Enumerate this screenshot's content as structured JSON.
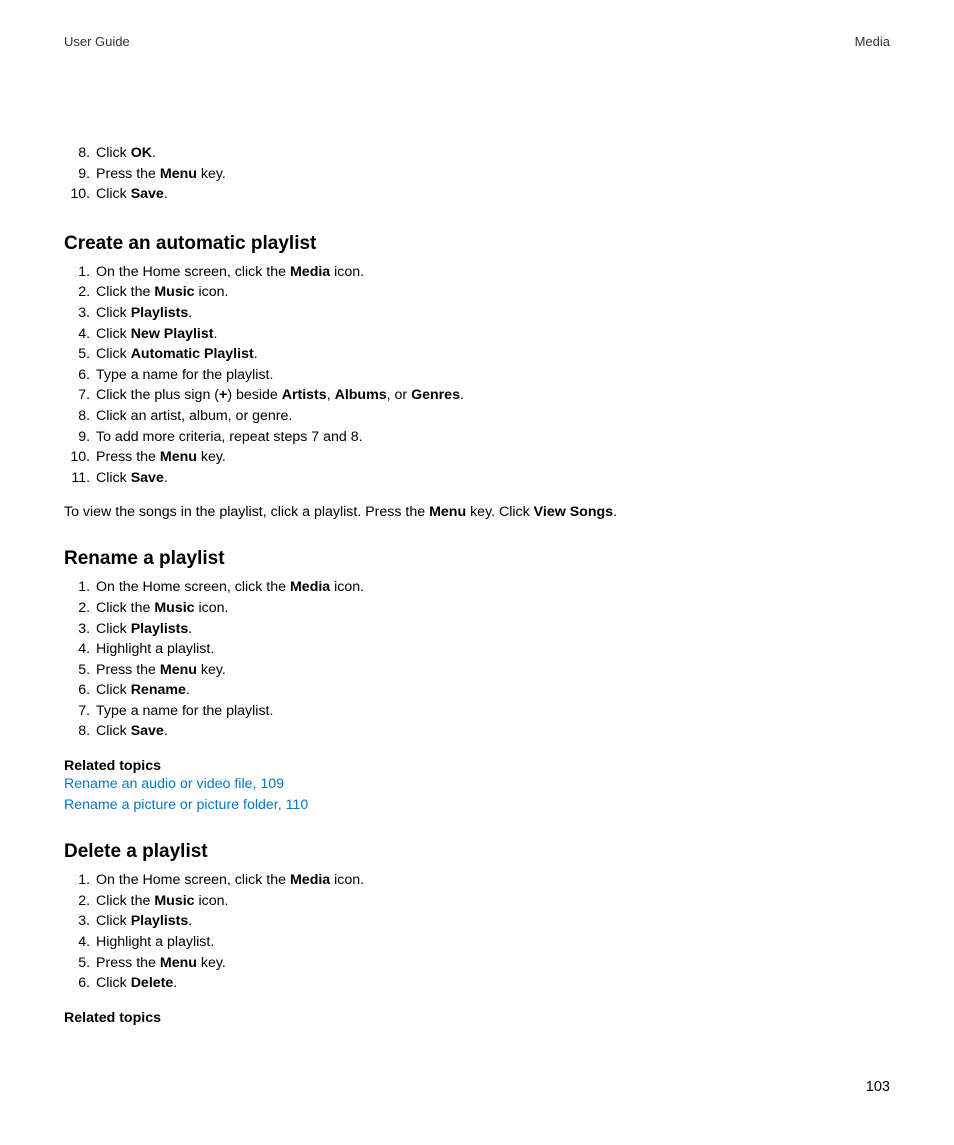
{
  "header": {
    "left": "User Guide",
    "right": "Media"
  },
  "top_list": {
    "start": 8,
    "items": [
      [
        {
          "t": "Click "
        },
        {
          "t": "OK",
          "b": true
        },
        {
          "t": "."
        }
      ],
      [
        {
          "t": "Press the "
        },
        {
          "t": "Menu",
          "b": true
        },
        {
          "t": " key."
        }
      ],
      [
        {
          "t": "Click "
        },
        {
          "t": "Save",
          "b": true
        },
        {
          "t": "."
        }
      ]
    ]
  },
  "section1": {
    "heading": "Create an automatic playlist",
    "items": [
      [
        {
          "t": "On the Home screen, click the "
        },
        {
          "t": "Media",
          "b": true
        },
        {
          "t": " icon."
        }
      ],
      [
        {
          "t": "Click the "
        },
        {
          "t": "Music",
          "b": true
        },
        {
          "t": " icon."
        }
      ],
      [
        {
          "t": "Click "
        },
        {
          "t": "Playlists",
          "b": true
        },
        {
          "t": "."
        }
      ],
      [
        {
          "t": "Click "
        },
        {
          "t": "New Playlist",
          "b": true
        },
        {
          "t": "."
        }
      ],
      [
        {
          "t": "Click "
        },
        {
          "t": "Automatic Playlist",
          "b": true
        },
        {
          "t": "."
        }
      ],
      [
        {
          "t": "Type a name for the playlist."
        }
      ],
      [
        {
          "t": "Click the plus sign ("
        },
        {
          "t": "+",
          "b": true
        },
        {
          "t": ") beside "
        },
        {
          "t": "Artists",
          "b": true
        },
        {
          "t": ", "
        },
        {
          "t": "Albums",
          "b": true
        },
        {
          "t": ", or "
        },
        {
          "t": "Genres",
          "b": true
        },
        {
          "t": "."
        }
      ],
      [
        {
          "t": "Click an artist, album, or genre."
        }
      ],
      [
        {
          "t": "To add more criteria, repeat steps 7 and 8."
        }
      ],
      [
        {
          "t": "Press the "
        },
        {
          "t": "Menu",
          "b": true
        },
        {
          "t": " key."
        }
      ],
      [
        {
          "t": "Click "
        },
        {
          "t": "Save",
          "b": true
        },
        {
          "t": "."
        }
      ]
    ],
    "note": [
      {
        "t": "To view the songs in the playlist, click a playlist. Press the "
      },
      {
        "t": "Menu",
        "b": true
      },
      {
        "t": " key. Click "
      },
      {
        "t": "View Songs",
        "b": true
      },
      {
        "t": "."
      }
    ]
  },
  "section2": {
    "heading": "Rename a playlist",
    "items": [
      [
        {
          "t": "On the Home screen, click the "
        },
        {
          "t": "Media",
          "b": true
        },
        {
          "t": " icon."
        }
      ],
      [
        {
          "t": "Click the "
        },
        {
          "t": "Music",
          "b": true
        },
        {
          "t": " icon."
        }
      ],
      [
        {
          "t": "Click "
        },
        {
          "t": "Playlists",
          "b": true
        },
        {
          "t": "."
        }
      ],
      [
        {
          "t": "Highlight a playlist."
        }
      ],
      [
        {
          "t": "Press the "
        },
        {
          "t": "Menu",
          "b": true
        },
        {
          "t": " key."
        }
      ],
      [
        {
          "t": "Click "
        },
        {
          "t": "Rename",
          "b": true
        },
        {
          "t": "."
        }
      ],
      [
        {
          "t": "Type a name for the playlist."
        }
      ],
      [
        {
          "t": "Click "
        },
        {
          "t": "Save",
          "b": true
        },
        {
          "t": "."
        }
      ]
    ],
    "related_heading": "Related topics",
    "related_links": [
      "Rename an audio or video file, 109",
      "Rename a picture or picture folder, 110"
    ]
  },
  "section3": {
    "heading": "Delete a playlist",
    "items": [
      [
        {
          "t": "On the Home screen, click the "
        },
        {
          "t": "Media",
          "b": true
        },
        {
          "t": " icon."
        }
      ],
      [
        {
          "t": "Click the "
        },
        {
          "t": "Music",
          "b": true
        },
        {
          "t": " icon."
        }
      ],
      [
        {
          "t": "Click "
        },
        {
          "t": "Playlists",
          "b": true
        },
        {
          "t": "."
        }
      ],
      [
        {
          "t": "Highlight a playlist."
        }
      ],
      [
        {
          "t": "Press the "
        },
        {
          "t": "Menu",
          "b": true
        },
        {
          "t": " key."
        }
      ],
      [
        {
          "t": "Click "
        },
        {
          "t": "Delete",
          "b": true
        },
        {
          "t": "."
        }
      ]
    ],
    "related_heading": "Related topics"
  },
  "page_number": "103"
}
